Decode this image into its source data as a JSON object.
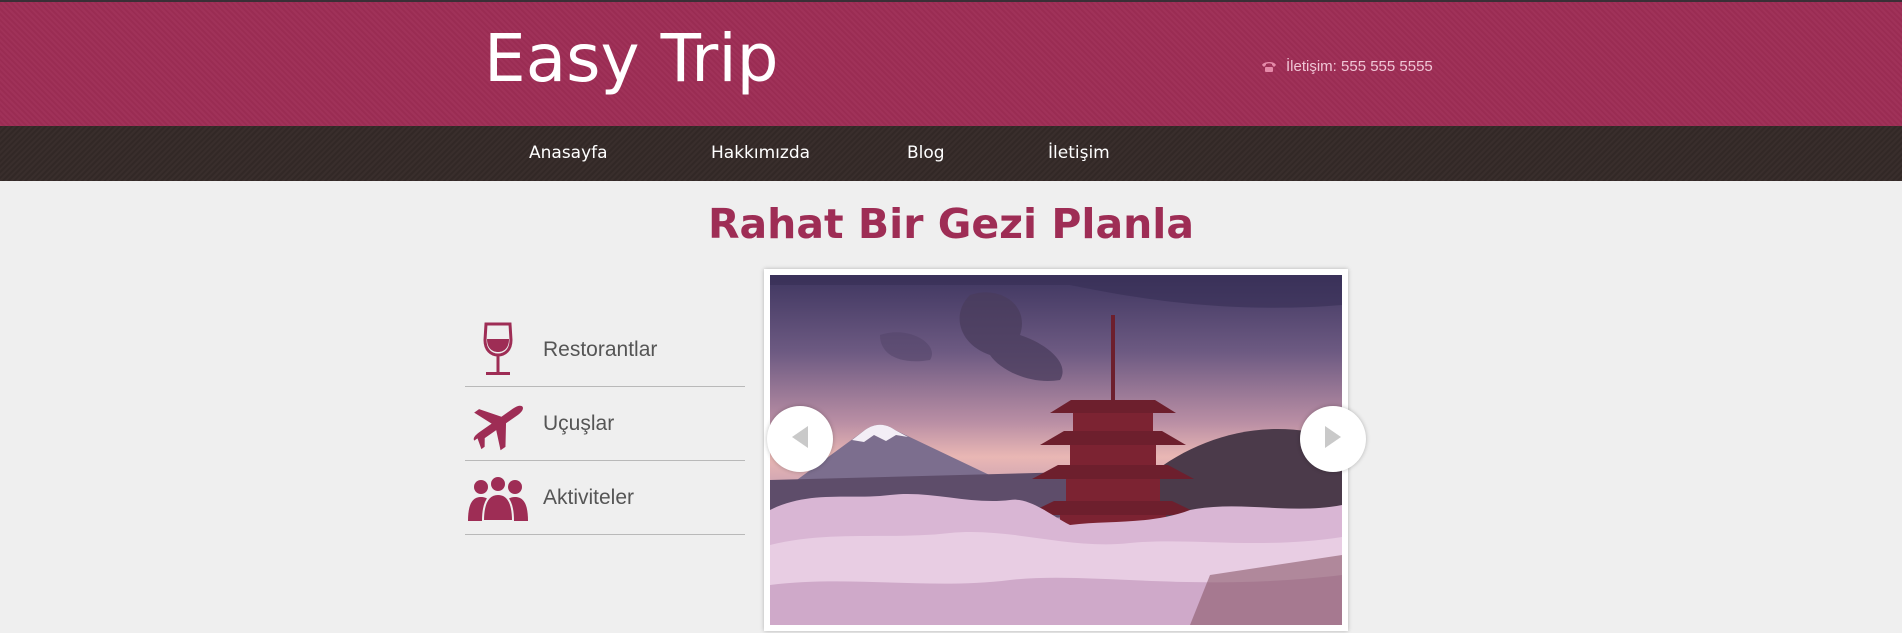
{
  "header": {
    "logo": "Easy Trip",
    "contact_text": "İletişim: 555 555 5555",
    "contact_icon": "phone-icon"
  },
  "nav": {
    "items": [
      {
        "label": "Anasayfa"
      },
      {
        "label": "Hakkımızda"
      },
      {
        "label": "Blog"
      },
      {
        "label": "İletişim"
      }
    ]
  },
  "main": {
    "headline": "Rahat Bir Gezi Planla"
  },
  "sidebar": {
    "items": [
      {
        "label": "Restorantlar",
        "icon": "wine-glass-icon"
      },
      {
        "label": "Uçuşlar",
        "icon": "airplane-icon"
      },
      {
        "label": "Aktiviteler",
        "icon": "people-group-icon"
      }
    ]
  },
  "slider": {
    "image": "pagoda-mount-fuji-cherry-blossom-photo",
    "prev_icon": "arrow-left-icon",
    "next_icon": "arrow-right-icon"
  },
  "colors": {
    "brand": "#9e2d55",
    "nav_bg": "#352a28",
    "page_bg": "#efefef",
    "text": "#555555"
  }
}
